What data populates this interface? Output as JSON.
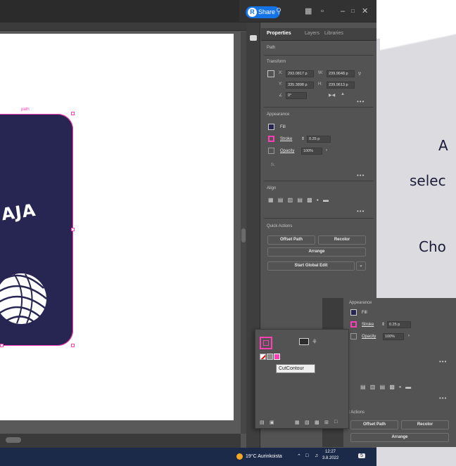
{
  "titlebar": {
    "share_label": "Share",
    "share_avatar": "R",
    "icons": [
      "search-icon",
      "workspace-icon",
      "arrange-icon",
      "minimize-icon",
      "maximize-icon",
      "close-icon"
    ]
  },
  "artwork": {
    "selection_label": "path",
    "logo_text": "AJA",
    "colors": {
      "artboard": "#272551",
      "selection": "#ff3db6"
    }
  },
  "panel": {
    "tabs": [
      "Properties",
      "Layers",
      "Libraries"
    ],
    "object_type": "Path",
    "transform": {
      "title": "Transform",
      "x_label": "X:",
      "x_value": "293.0817 p",
      "y_label": "Y:",
      "y_value": "335.3898 p",
      "w_label": "W:",
      "w_value": "239.9648 p",
      "h_label": "H:",
      "h_value": "239.9613 p",
      "angle_value": "0°"
    },
    "appearance": {
      "title": "Appearance",
      "fill_label": "Fill",
      "stroke_label": "Stroke",
      "stroke_weight": "0.25 p",
      "opacity_label": "Opacity",
      "opacity_value": "100%",
      "fx_label": "fx."
    },
    "align": {
      "title": "Align"
    },
    "quick_actions": {
      "title": "Quick Actions",
      "offset_path": "Offset Path",
      "recolor": "Recolor",
      "arrange": "Arrange",
      "start_global_edit": "Start Global Edit"
    },
    "more": "•••"
  },
  "slide": {
    "line1": "A",
    "line2": "selec",
    "line3": "Cho"
  },
  "inset_appearance": {
    "title": "Appearance",
    "fill_label": "Fill",
    "stroke_label": "Stroke",
    "stroke_weight": "0.25 p",
    "opacity_label": "Opacity",
    "opacity_value": "100%",
    "actions_label": "k Actions",
    "offset_path": "Offset Path",
    "recolor": "Recolor",
    "arrange": "Arrange"
  },
  "swatch_popup": {
    "tooltip": "CutContour"
  },
  "taskbar": {
    "weather": "19°C  Aurinkoista",
    "time": "12:27",
    "date": "3.8.2022",
    "badge": "5"
  }
}
